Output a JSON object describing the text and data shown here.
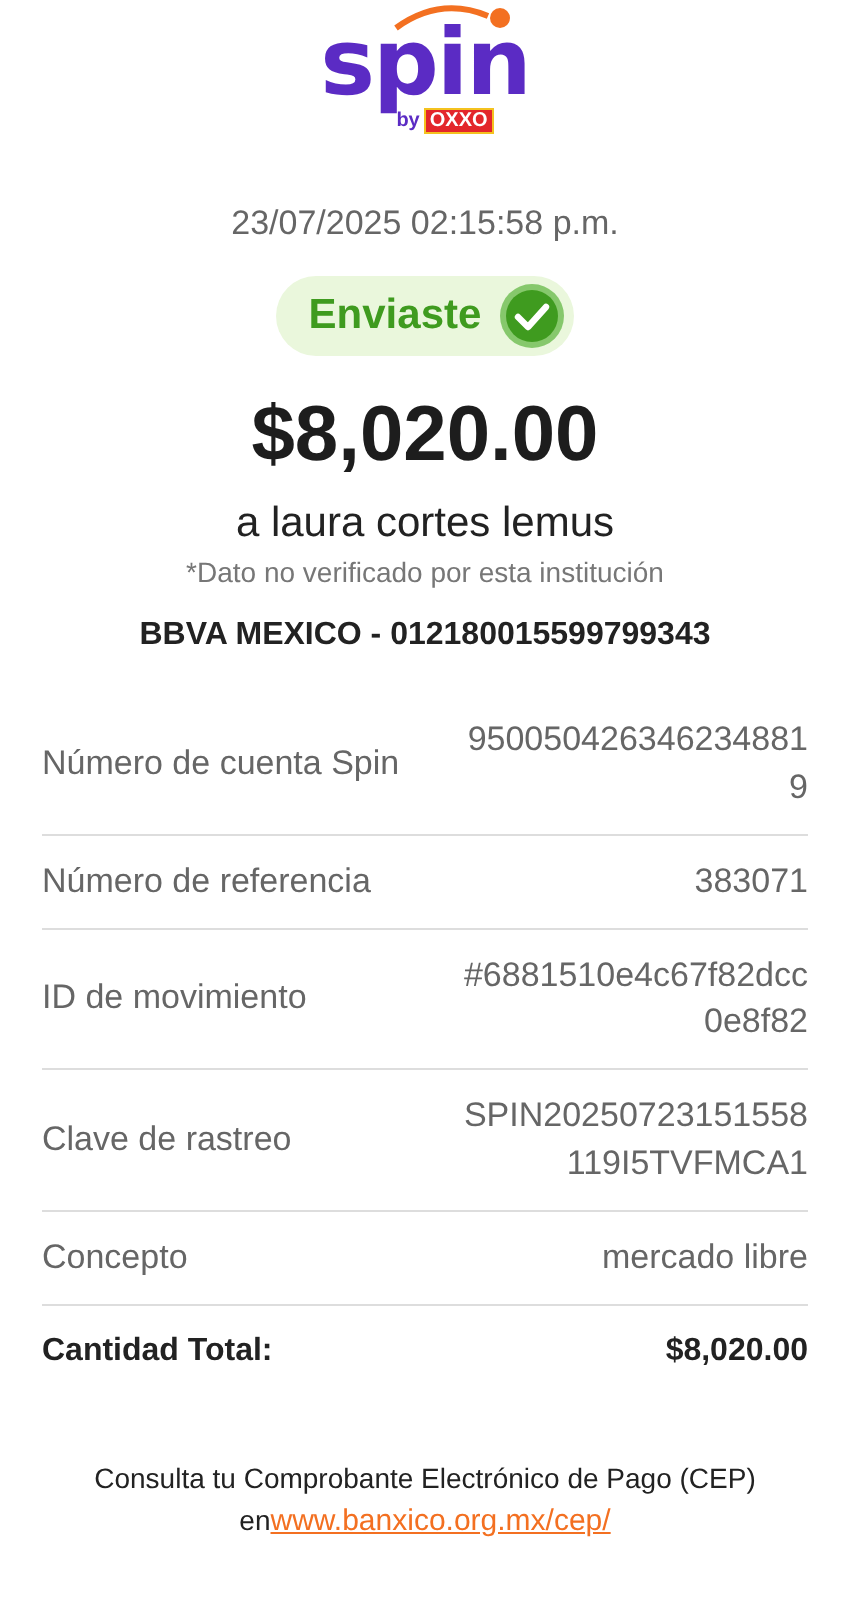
{
  "logo": {
    "brand": "spin",
    "by": "by",
    "partner": "OXXO"
  },
  "datetime": "23/07/2025 02:15:58 p.m.",
  "status": {
    "label": "Enviaste",
    "done": true
  },
  "amount": "$8,020.00",
  "recipient": "a laura cortes lemus",
  "disclaimer": "*Dato no verificado por esta institución",
  "bank_account": "BBVA MEXICO - 012180015599799343",
  "details": [
    {
      "kind": "detail",
      "label": "Número de cuenta Spin",
      "value": "9500504263462348819"
    },
    {
      "kind": "detail",
      "label": "Número de referencia",
      "value": "383071"
    },
    {
      "kind": "detail",
      "label": "ID de movimiento",
      "value": "#6881510e4c67f82dcc0e8f82"
    },
    {
      "kind": "detail",
      "label": "Clave de rastreo",
      "value": "SPIN20250723151558119I5TVFMCA1"
    },
    {
      "kind": "detail",
      "label": "Concepto",
      "value": "mercado libre"
    },
    {
      "kind": "total",
      "label": "Cantidad Total:",
      "value": "$8,020.00"
    }
  ],
  "footer": {
    "text": "Consulta tu Comprobante Electrónico de Pago (CEP) en",
    "link": "www.banxico.org.mx/cep/"
  }
}
